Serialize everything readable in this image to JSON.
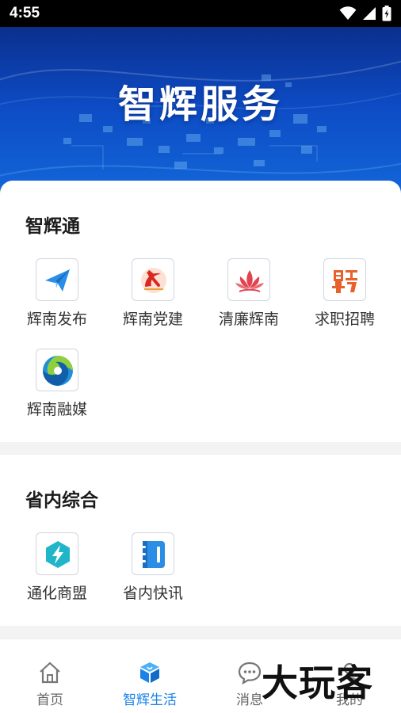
{
  "status_bar": {
    "time": "4:55",
    "icons": [
      "wifi-icon",
      "signal-icon",
      "battery-charging-icon"
    ]
  },
  "banner": {
    "title": "智辉服务"
  },
  "sections": [
    {
      "title": "智辉通",
      "items": [
        {
          "label": "辉南发布",
          "icon": "paper-plane-icon"
        },
        {
          "label": "辉南党建",
          "icon": "hammer-sickle-icon"
        },
        {
          "label": "清廉辉南",
          "icon": "lotus-icon"
        },
        {
          "label": "求职招聘",
          "icon": "recruit-pin-icon"
        },
        {
          "label": "辉南融媒",
          "icon": "swirl-logo-icon"
        }
      ]
    },
    {
      "title": "省内综合",
      "items": [
        {
          "label": "通化商盟",
          "icon": "lightning-hexagon-icon"
        },
        {
          "label": "省内快讯",
          "icon": "notebook-icon"
        }
      ]
    }
  ],
  "tab_bar": {
    "active": "智辉生活",
    "tabs": [
      {
        "label": "首页",
        "icon": "home-icon"
      },
      {
        "label": "智辉生活",
        "icon": "cube-life-icon"
      },
      {
        "label": "消息",
        "icon": "chat-bubble-icon"
      },
      {
        "label": "我的",
        "icon": "user-icon"
      }
    ]
  },
  "watermark": {
    "text": "大玩客"
  },
  "colors": {
    "banner_dark": "#0b2f8d",
    "banner_light": "#1368db",
    "active_tab": "#1a82e8",
    "party_red": "#d9281f",
    "lotus_red": "#e2434f",
    "recruit_orange": "#e8612a"
  }
}
